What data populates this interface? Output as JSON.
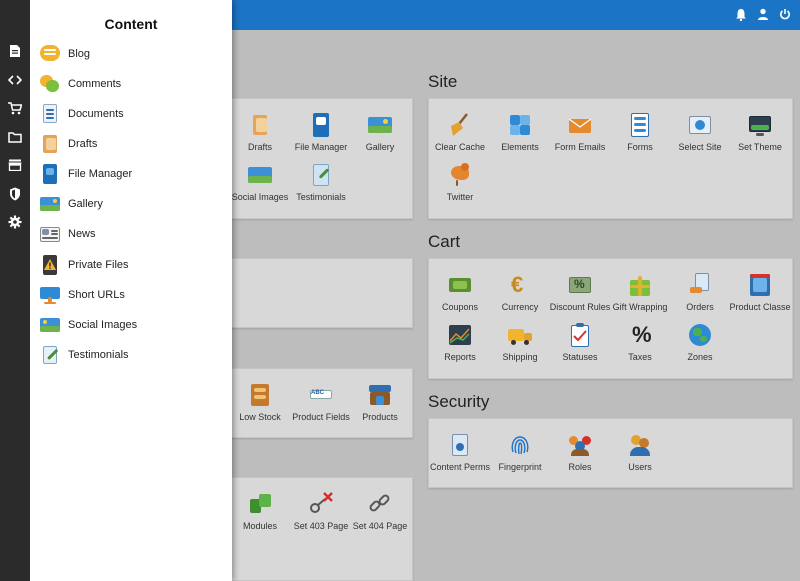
{
  "drawer": {
    "title": "Content",
    "items": [
      {
        "label": "Blog",
        "icon": "blog-icon"
      },
      {
        "label": "Comments",
        "icon": "comments-icon"
      },
      {
        "label": "Documents",
        "icon": "documents-icon"
      },
      {
        "label": "Drafts",
        "icon": "drafts-icon"
      },
      {
        "label": "File Manager",
        "icon": "file-manager-icon"
      },
      {
        "label": "Gallery",
        "icon": "gallery-icon"
      },
      {
        "label": "News",
        "icon": "news-icon"
      },
      {
        "label": "Private Files",
        "icon": "private-files-icon"
      },
      {
        "label": "Short URLs",
        "icon": "short-urls-icon"
      },
      {
        "label": "Social Images",
        "icon": "social-images-icon"
      },
      {
        "label": "Testimonials",
        "icon": "testimonials-icon"
      }
    ]
  },
  "rail": [
    "document-icon",
    "code-icon",
    "cart-icon",
    "folder-icon",
    "store-icon",
    "shield-icon",
    "gear-icon"
  ],
  "topbar": {
    "icons": [
      "bell-icon",
      "user-icon",
      "power-icon"
    ],
    "color": "#1c74c6"
  },
  "content_partial": {
    "tiles": [
      {
        "label": "Drafts",
        "icon": "drafts-icon"
      },
      {
        "label": "File Manager",
        "icon": "file-manager-icon"
      },
      {
        "label": "Gallery",
        "icon": "gallery-icon"
      },
      {
        "label": "Social Images",
        "icon": "social-images-icon"
      },
      {
        "label": "Testimonials",
        "icon": "testimonials-icon"
      }
    ]
  },
  "catalog_partial": {
    "tiles": [
      {
        "label": "Low Stock",
        "icon": "low-stock-icon"
      },
      {
        "label": "Product Fields",
        "icon": "product-fields-icon"
      },
      {
        "label": "Products",
        "icon": "products-icon"
      }
    ]
  },
  "system_partial": {
    "tiles": [
      {
        "label": "Modules",
        "icon": "modules-icon"
      },
      {
        "label": "Set 403 Page",
        "icon": "set-403-page-icon"
      },
      {
        "label": "Set 404 Page",
        "icon": "set-404-page-icon"
      }
    ]
  },
  "site": {
    "title": "Site",
    "tiles": [
      {
        "label": "Clear Cache",
        "icon": "broom-icon"
      },
      {
        "label": "Elements",
        "icon": "puzzle-icon"
      },
      {
        "label": "Form Emails",
        "icon": "envelope-icon"
      },
      {
        "label": "Forms",
        "icon": "form-icon"
      },
      {
        "label": "Select Site",
        "icon": "select-site-icon"
      },
      {
        "label": "Set Theme",
        "icon": "set-theme-icon"
      },
      {
        "label": "Twitter",
        "icon": "twitter-icon"
      }
    ]
  },
  "cart": {
    "title": "Cart",
    "tiles": [
      {
        "label": "Coupons",
        "icon": "coupons-icon"
      },
      {
        "label": "Currency",
        "icon": "currency-icon"
      },
      {
        "label": "Discount Rules",
        "icon": "discount-rules-icon"
      },
      {
        "label": "Gift Wrapping",
        "icon": "gift-icon"
      },
      {
        "label": "Orders",
        "icon": "orders-icon"
      },
      {
        "label": "Product Classe",
        "icon": "product-classes-icon"
      },
      {
        "label": "Reports",
        "icon": "reports-icon"
      },
      {
        "label": "Shipping",
        "icon": "shipping-icon"
      },
      {
        "label": "Statuses",
        "icon": "statuses-icon"
      },
      {
        "label": "Taxes",
        "icon": "taxes-icon"
      },
      {
        "label": "Zones",
        "icon": "zones-icon"
      }
    ]
  },
  "security": {
    "title": "Security",
    "tiles": [
      {
        "label": "Content Perms",
        "icon": "content-perms-icon"
      },
      {
        "label": "Fingerprint",
        "icon": "fingerprint-icon"
      },
      {
        "label": "Roles",
        "icon": "roles-icon"
      },
      {
        "label": "Users",
        "icon": "users-icon"
      }
    ]
  }
}
